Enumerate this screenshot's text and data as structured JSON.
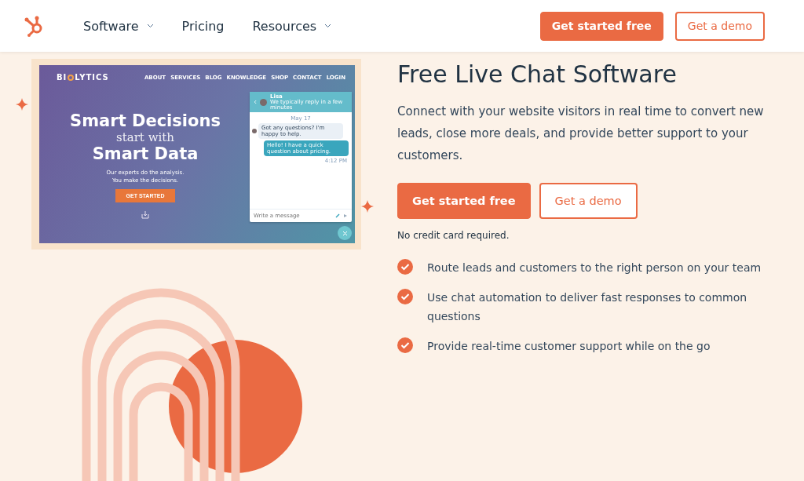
{
  "header": {
    "nav": [
      {
        "label": "Software",
        "dropdown": true
      },
      {
        "label": "Pricing",
        "dropdown": false
      },
      {
        "label": "Resources",
        "dropdown": true
      }
    ],
    "buttons": [
      {
        "label": "Get started free",
        "kind": "primary"
      },
      {
        "label": "Get a demo",
        "kind": "secondary"
      }
    ]
  },
  "preview": {
    "brand_start": "BI",
    "brand_end": "LYTICS",
    "nav": [
      "ABOUT",
      "SERVICES",
      "BLOG",
      "KNOWLEDGE",
      "SHOP",
      "CONTACT",
      "LOGIN"
    ],
    "headline_top": "Smart Decisions",
    "headline_middle": "start with",
    "headline_bottom": "Smart Data",
    "tagline": [
      "Our experts do the analysis.",
      "You make the decisions."
    ],
    "cta": "GET STARTED",
    "chat": {
      "agent": "Lisa",
      "status": "We typically reply in a few minutes",
      "date": "May 17",
      "messages": [
        {
          "kind": "incoming",
          "text": "Got any questions? I'm happy to help."
        },
        {
          "kind": "outgoing",
          "text": "Hello! I have a quick question about pricing."
        }
      ],
      "time": "4:12 PM",
      "placeholder": "Write a message"
    }
  },
  "hero": {
    "title": "Free Live Chat Software",
    "description": "Connect with your website visitors in real time to convert new leads, close more deals, and provide better support to your customers.",
    "buttons": [
      {
        "label": "Get started free",
        "kind": "primary"
      },
      {
        "label": "Get a demo",
        "kind": "secondary"
      }
    ],
    "note": "No credit card required.",
    "features": [
      "Route leads and customers to the right person on your team",
      "Use chat automation to deliver fast responses to common questions",
      "Provide real-time customer support while on the go"
    ]
  }
}
